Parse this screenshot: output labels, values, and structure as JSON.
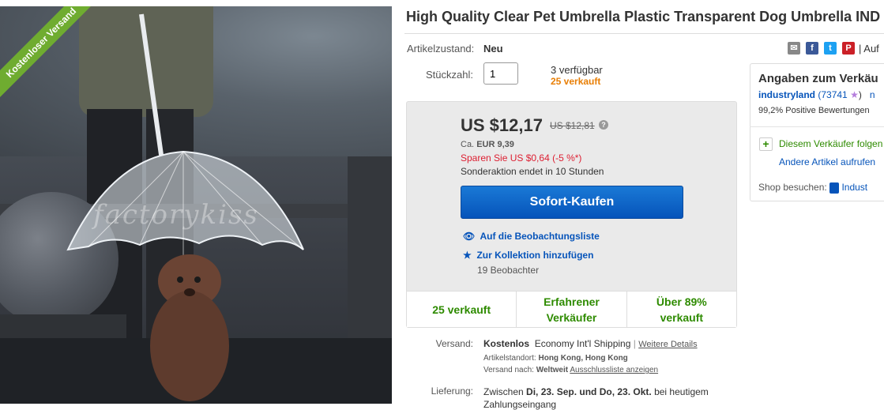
{
  "product": {
    "title": "High Quality Clear Pet Umbrella Plastic Transparent Dog Umbrella IND",
    "image": {
      "ribbon": "Kostenloser Versand",
      "watermark": "factorykiss"
    }
  },
  "details": {
    "condition_label": "Artikelzustand:",
    "condition_value": "Neu",
    "quantity_label": "Stückzahl:",
    "quantity_value": "1",
    "available": "3 verfügbar",
    "sold": "25 verkauft"
  },
  "share": {
    "icons": [
      "email-icon",
      "facebook-icon",
      "twitter-icon",
      "pinterest-icon"
    ],
    "watch_text": "| Auf"
  },
  "buybox": {
    "price": "US $12,17",
    "old_price": "US $12,81",
    "eur_prefix": "Ca.",
    "eur_price": "EUR 9,39",
    "save": "Sparen Sie US $0,64 (-5 %*)",
    "promo_end": "Sonderaktion endet in 10 Stunden",
    "buy_label": "Sofort-Kaufen",
    "watchlist_label": "Auf die Beobachtungsliste",
    "collection_label": "Zur Kollektion hinzufügen",
    "watchers": "19 Beobachter",
    "stats": [
      {
        "line1": "25 verkauft",
        "line2": ""
      },
      {
        "line1": "Erfahrener",
        "line2": "Verkäufer"
      },
      {
        "line1": "Über 89%",
        "line2": "verkauft"
      }
    ]
  },
  "shipping": {
    "label": "Versand:",
    "cost": "Kostenlos",
    "service": "Economy Int'l Shipping",
    "separator": "|",
    "details_link": "Weitere Details",
    "location_label": "Artikelstandort:",
    "location_value": "Hong Kong, Hong Kong",
    "to_label": "Versand nach:",
    "to_value": "Weltweit",
    "exclusion_link": "Ausschlussliste anzeigen"
  },
  "delivery": {
    "label": "Lieferung:",
    "line1_pre": "Zwischen",
    "line1_bold": "Di, 23. Sep. und Do, 23. Okt.",
    "line1_post": "bei heutigem",
    "line2": "Zahlungseingang"
  },
  "seller": {
    "heading": "Angaben zum Verkäu",
    "name": "industryland",
    "score": "(73741",
    "score_close": ")",
    "more": "n",
    "positive": "99,2% Positive Bewertungen",
    "follow": "Diesem Verkäufer folgen",
    "other_items": "Andere Artikel aufrufen",
    "shop_label": "Shop besuchen:",
    "shop_name": "Indust"
  },
  "colors": {
    "ribbon": "#6fac30",
    "buy_button": "#0654ba",
    "stat_green": "#2e8b00",
    "save_red": "#dd1e31",
    "sold_orange": "#e87e04",
    "link_blue": "#0654ba"
  }
}
